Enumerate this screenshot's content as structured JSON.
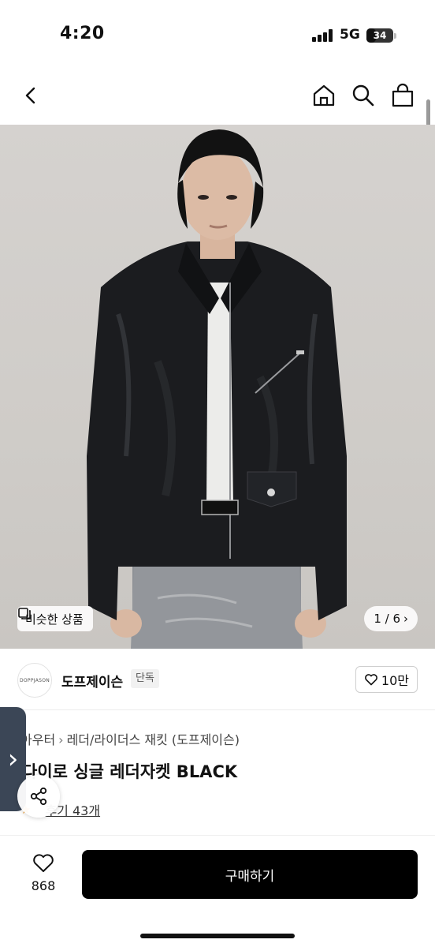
{
  "status_bar": {
    "time": "4:20",
    "network": "5G",
    "battery": "34",
    "battery_level": 0.34
  },
  "nav": {
    "back_icon": "chevron-left-icon",
    "home_icon": "home-icon",
    "search_icon": "search-icon",
    "cart_icon": "shopping-bag-icon"
  },
  "gallery": {
    "similar_label": "비슷한 상품",
    "page_indicator": "1 / 6",
    "next_icon": "chevron-right-icon"
  },
  "brand": {
    "logo_text": "DOPPJASON",
    "name": "도프제이슨",
    "badge": "단독",
    "like_count": "10만"
  },
  "product": {
    "breadcrumb": [
      "아우터",
      "레더/라이더스 재킷 (도프제이슨)"
    ],
    "title": "다이로 싱글 레더자켓 BLACK",
    "review_label": "후기 43개",
    "side_tab_icon": "›"
  },
  "bottom_bar": {
    "wish_count": "868",
    "buy_label": "구매하기"
  },
  "colors": {
    "accent": "#000000",
    "side_tab": "#3b4656",
    "star": "#f2a33a"
  }
}
